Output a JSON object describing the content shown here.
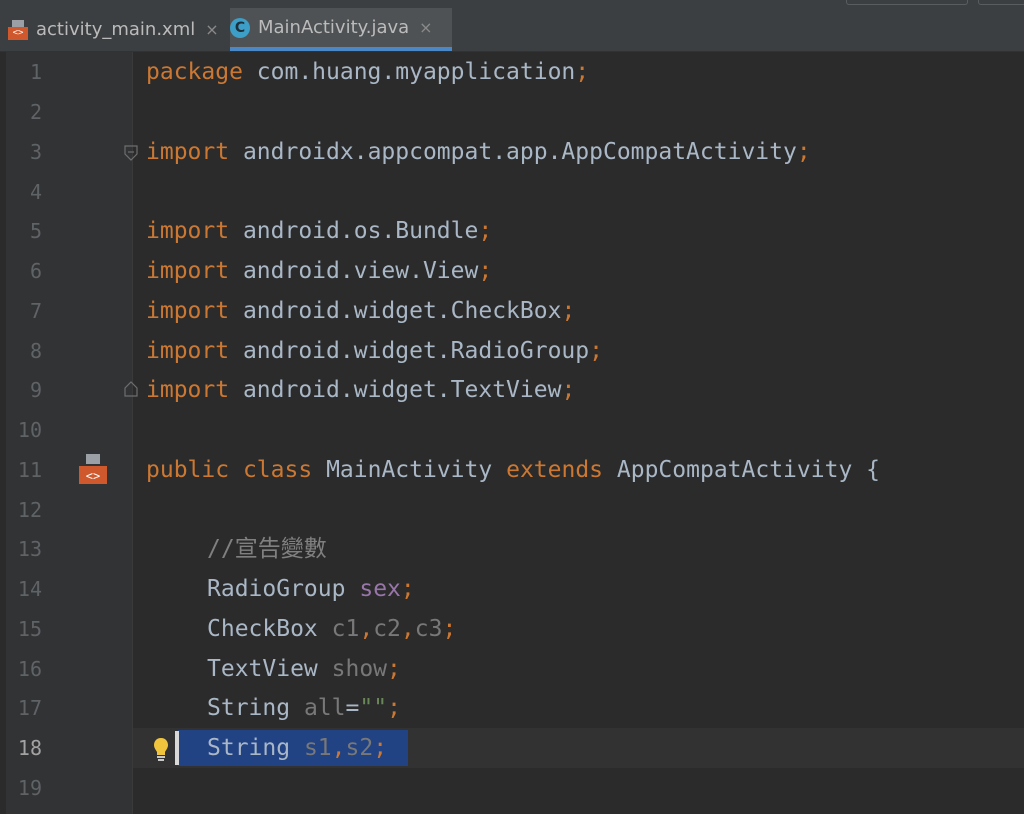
{
  "tabs": [
    {
      "label": "activity_main.xml",
      "icon": "xml-file-icon",
      "active": false
    },
    {
      "label": "MainActivity.java",
      "icon": "java-class-icon",
      "active": true
    }
  ],
  "tab_close_glyph": "×",
  "xml_icon_glyph": "<>",
  "class_icon_glyph": "C",
  "current_line": 18,
  "lines": [
    {
      "num": "1"
    },
    {
      "num": "2"
    },
    {
      "num": "3"
    },
    {
      "num": "4"
    },
    {
      "num": "5"
    },
    {
      "num": "6"
    },
    {
      "num": "7"
    },
    {
      "num": "8"
    },
    {
      "num": "9"
    },
    {
      "num": "10"
    },
    {
      "num": "11"
    },
    {
      "num": "12"
    },
    {
      "num": "13"
    },
    {
      "num": "14"
    },
    {
      "num": "15"
    },
    {
      "num": "16"
    },
    {
      "num": "17"
    },
    {
      "num": "18"
    },
    {
      "num": "19"
    }
  ],
  "code": {
    "l1": {
      "kw": "package",
      "rest": " com.huang.myapplication",
      "semi": ";"
    },
    "l3": {
      "kw": "import",
      "rest": " androidx.appcompat.app.AppCompatActivity",
      "semi": ";"
    },
    "l5": {
      "kw": "import",
      "rest": " android.os.Bundle",
      "semi": ";"
    },
    "l6": {
      "kw": "import",
      "rest": " android.view.View",
      "semi": ";"
    },
    "l7": {
      "kw": "import",
      "rest": " android.widget.CheckBox",
      "semi": ";"
    },
    "l8": {
      "kw": "import",
      "rest": " android.widget.RadioGroup",
      "semi": ";"
    },
    "l9": {
      "kw": "import",
      "rest": " android.widget.TextView",
      "semi": ";"
    },
    "l11": {
      "kw1": "public",
      "kw2": "class",
      "name": "MainActivity",
      "kw3": "extends",
      "parent": "AppCompatActivity",
      "brace": "{"
    },
    "l13": {
      "comment": "//宣告變數"
    },
    "l14": {
      "type": "RadioGroup",
      "field": "sex",
      "semi": ";"
    },
    "l15": {
      "type": "CheckBox",
      "f1": "c1",
      "c1": ",",
      "f2": "c2",
      "c2": ",",
      "f3": "c3",
      "semi": ";"
    },
    "l16": {
      "type": "TextView",
      "field": "show",
      "semi": ";"
    },
    "l17": {
      "type": "String",
      "field": "all",
      "eq": "=",
      "str": "\"\"",
      "semi": ";"
    },
    "l18": {
      "type": "String",
      "f1": "s1",
      "comma": ",",
      "f2": "s2",
      "semi": ";"
    }
  },
  "colors": {
    "keyword": "#cc7832",
    "identifier": "#a9b7c6",
    "field_purple": "#9876aa",
    "field_unused": "#787878",
    "comment": "#808080",
    "string": "#6a8759",
    "selection": "#214283",
    "tab_underline": "#4a88c7"
  }
}
